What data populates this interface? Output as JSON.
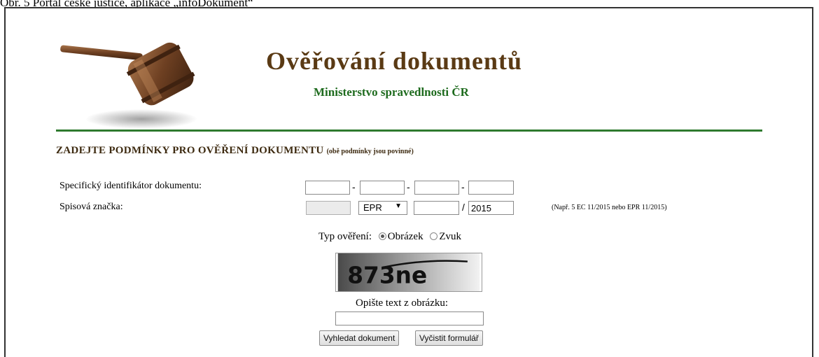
{
  "caption": "Obr. 5 Portál české justice, aplikace „infoDokument“",
  "header": {
    "title": "Ověřování dokumentů",
    "subtitle": "Ministerstvo spravedlnosti ČR"
  },
  "form": {
    "heading": "ZADEJTE PODMÍNKY PRO OVĚŘENÍ DOKUMENTU",
    "heading_note": "(obě podmínky jsou povinné)",
    "identifier_label": "Specifický identifikátor dokumentu:",
    "identifier_separator": "-",
    "spisova_label": "Spisová značka:",
    "agenda_selected": "EPR",
    "year_separator": "/",
    "year_value": "2015",
    "example": "(Např. 5 EC 11/2015 nebo EPR 11/2015)",
    "verification_type_label": "Typ ověření:",
    "verification_options": [
      "Obrázek",
      "Zvuk"
    ],
    "captcha_text": "873ne",
    "captcha_prompt": "Opište text z obrázku:",
    "search_button": "Vyhledat dokument",
    "clear_button": "Vyčistit formulář"
  },
  "colors": {
    "title": "#5a3a14",
    "subtitle": "#1e6b1e",
    "rule": "#2f7a2f"
  },
  "icons": {
    "logo": "gavel-icon"
  }
}
